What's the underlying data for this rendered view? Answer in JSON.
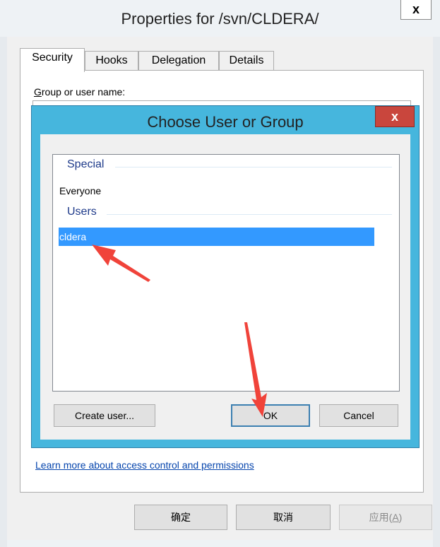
{
  "outer_window": {
    "title": "Properties for /svn/CLDERA/",
    "close_label": "x",
    "tabs": [
      "Security",
      "Hooks",
      "Delegation",
      "Details"
    ],
    "group_label_prefix": "G",
    "group_label_rest": "roup or user name:",
    "learn_more_link": "Learn more about access control and permissions",
    "buttons": {
      "ok": "确定",
      "cancel": "取消",
      "apply_text": "应用(",
      "apply_underline": "A",
      "apply_tail": ")"
    }
  },
  "dialog": {
    "title": "Choose User or Group",
    "close_label": "x",
    "groups": [
      {
        "header": "Special",
        "items": [
          "Everyone"
        ]
      },
      {
        "header": "Users",
        "items": [
          "cldera"
        ]
      }
    ],
    "selected_item": "cldera",
    "buttons": {
      "create_user": "Create user...",
      "ok": "OK",
      "cancel": "Cancel"
    }
  },
  "colors": {
    "dialog_frame": "#46b6dd",
    "selection": "#3399ff",
    "close_button": "#c9463d",
    "annotation_arrow": "#f0433a",
    "group_header": "#1e3a8a",
    "link": "#0645ad"
  }
}
